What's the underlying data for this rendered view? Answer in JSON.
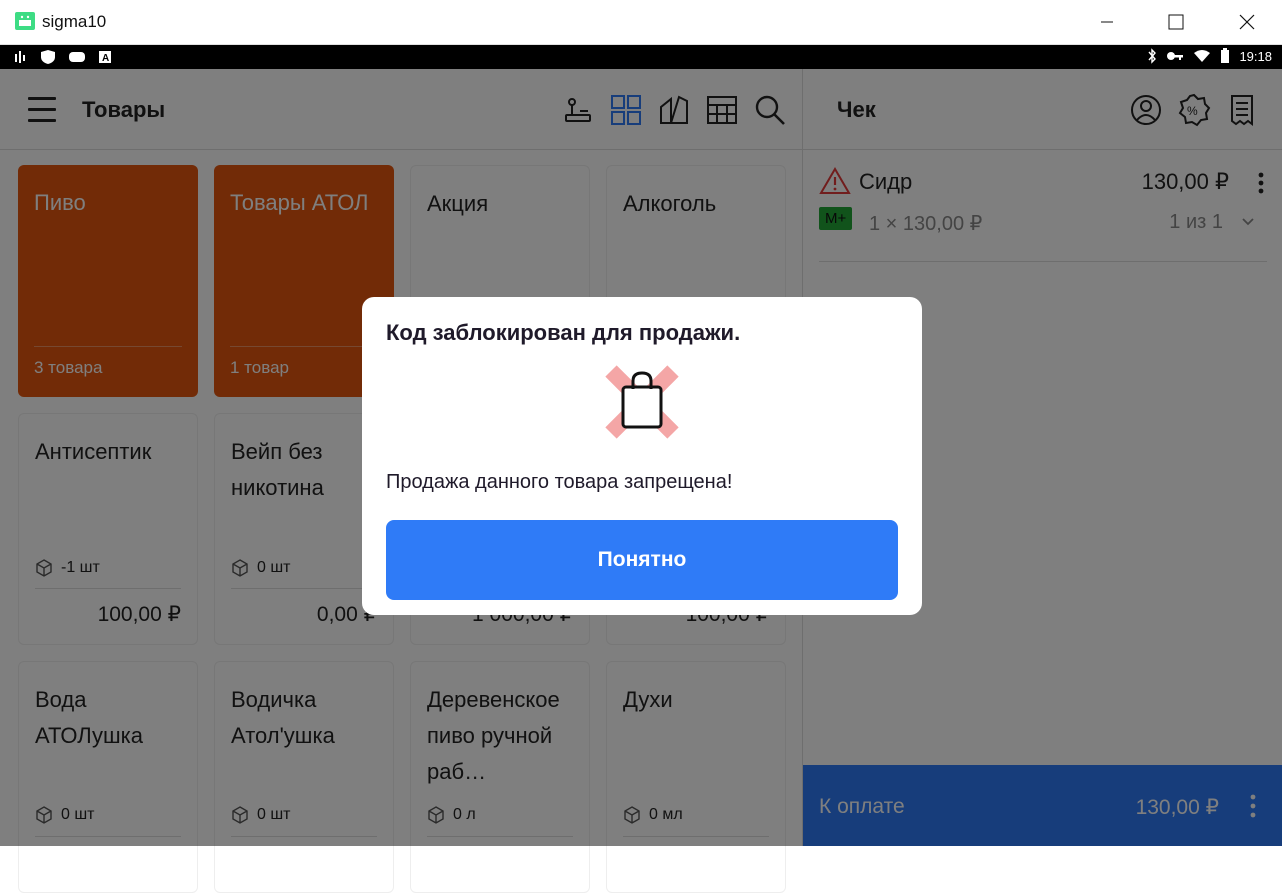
{
  "window": {
    "title": "sigma10"
  },
  "statusbar": {
    "time": "19:18"
  },
  "left": {
    "title": "Товары",
    "tiles": [
      {
        "name": "Пиво",
        "count": "3 товара",
        "kind": "folder"
      },
      {
        "name": "Товары АТОЛ",
        "count": "1 товар",
        "kind": "folder"
      },
      {
        "name": "Акция",
        "kind": "folder-plain"
      },
      {
        "name": "Алкоголь",
        "kind": "folder-plain"
      },
      {
        "name": "Антисептик",
        "stock": "-1 шт",
        "price": "100,00 ₽"
      },
      {
        "name": "Вейп без никотина",
        "stock": "0 шт",
        "price": "0,00 ₽"
      },
      {
        "name": "",
        "price": "1 000,00 ₽"
      },
      {
        "name": "",
        "price": "100,00 ₽"
      },
      {
        "name": "Вода АТОЛушка",
        "stock": "0 шт"
      },
      {
        "name": "Водичка Атол'ушка",
        "stock": "0 шт"
      },
      {
        "name": "Деревенское пиво ручной раб…",
        "stock": "0 л"
      },
      {
        "name": "Духи",
        "stock": "0 мл"
      }
    ]
  },
  "right": {
    "title": "Чек",
    "item": {
      "name": "Сидр",
      "price": "130,00 ₽",
      "badge": "М+",
      "qty": "1 × 130,00 ₽",
      "of": "1 из 1"
    },
    "pay": {
      "label": "К оплате",
      "amount": "130,00 ₽"
    }
  },
  "dialog": {
    "title": "Код заблокирован для продажи.",
    "message": "Продажа данного товара запрещена!",
    "button": "Понятно"
  },
  "colors": {
    "accent": "#2f7bf7",
    "folder": "#e4570e",
    "badge": "#22a637"
  }
}
